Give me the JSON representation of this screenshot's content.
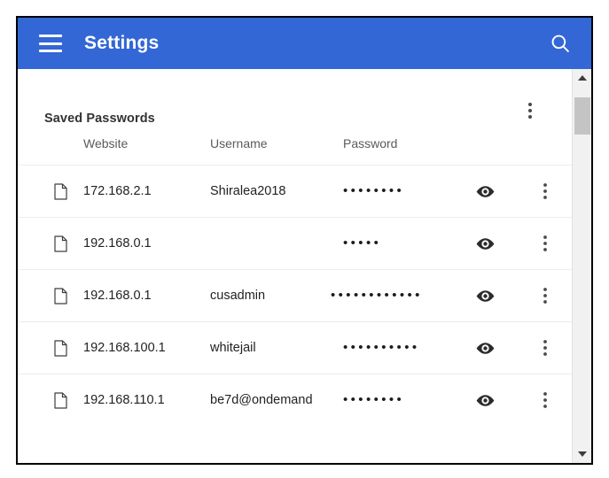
{
  "app_bar": {
    "title": "Settings",
    "menu_icon": "hamburger-menu-icon",
    "search_icon": "search-icon",
    "background_color": "#3367D6",
    "text_color": "#FFFFFF"
  },
  "card": {
    "section_title": "Saved Passwords",
    "overflow_icon": "more-vert-icon"
  },
  "table": {
    "columns": {
      "website": "Website",
      "username": "Username",
      "password": "Password"
    },
    "rows": [
      {
        "icon": "page-icon",
        "website": "172.168.2.1",
        "username": "Shiralea2018",
        "password_masked": "••••••••",
        "password_dot_count": 8,
        "reveal_icon": "eye-icon",
        "overflow_icon": "more-vert-icon"
      },
      {
        "icon": "page-icon",
        "website": "192.168.0.1",
        "username": "",
        "password_masked": "•••••",
        "password_dot_count": 5,
        "reveal_icon": "eye-icon",
        "overflow_icon": "more-vert-icon"
      },
      {
        "icon": "page-icon",
        "website": "192.168.0.1",
        "username": "cusadmin",
        "password_masked": "••••••••••••",
        "password_dot_count": 12,
        "reveal_icon": "eye-icon",
        "overflow_icon": "more-vert-icon"
      },
      {
        "icon": "page-icon",
        "website": "192.168.100.1",
        "username": "whitejail",
        "password_masked": "••••••••••",
        "password_dot_count": 10,
        "reveal_icon": "eye-icon",
        "overflow_icon": "more-vert-icon"
      },
      {
        "icon": "page-icon",
        "website": "192.168.110.1",
        "username": "be7d@ondemand",
        "password_masked": "••••••••",
        "password_dot_count": 8,
        "reveal_icon": "eye-icon",
        "overflow_icon": "more-vert-icon"
      }
    ]
  },
  "scrollbar": {
    "up_arrow_icon": "scroll-up-arrow-icon",
    "down_arrow_icon": "scroll-down-arrow-icon",
    "thumb": "scrollbar-thumb"
  }
}
